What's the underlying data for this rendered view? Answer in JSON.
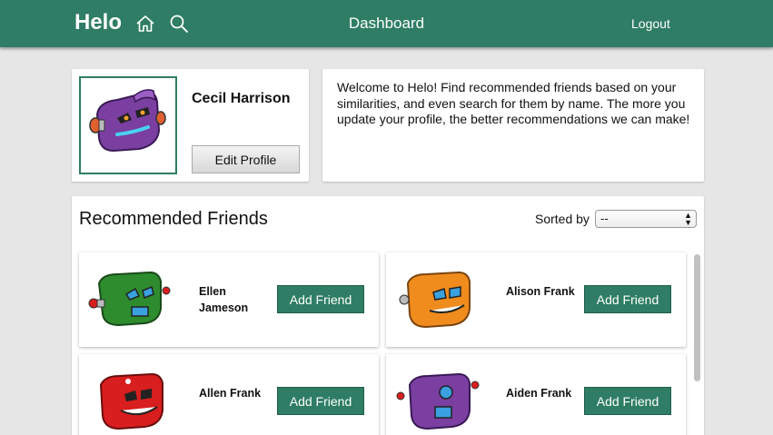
{
  "header": {
    "brand": "Helo",
    "title": "Dashboard",
    "logout": "Logout",
    "icons": [
      "home-icon",
      "search-icon"
    ]
  },
  "profile": {
    "name": "Cecil Harrison",
    "edit_label": "Edit Profile"
  },
  "welcome": {
    "text": "Welcome to Helo! Find recommended friends based on your similarities, and even search for them by name. The more you update your profile, the better recommendations we can make!"
  },
  "friends": {
    "title": "Recommended Friends",
    "sort_label": "Sorted by",
    "sort_value": "--",
    "add_label": "Add Friend",
    "items": [
      {
        "name": "Ellen Jameson",
        "color": "#2e8b2e"
      },
      {
        "name": "Alison Frank",
        "color": "#f08c1e"
      },
      {
        "name": "Allen Frank",
        "color": "#d81e1e"
      },
      {
        "name": "Aiden Frank",
        "color": "#7a3fa0"
      }
    ]
  },
  "colors": {
    "accent": "#2e7d64",
    "profile_avatar": "#7a3fa0"
  }
}
